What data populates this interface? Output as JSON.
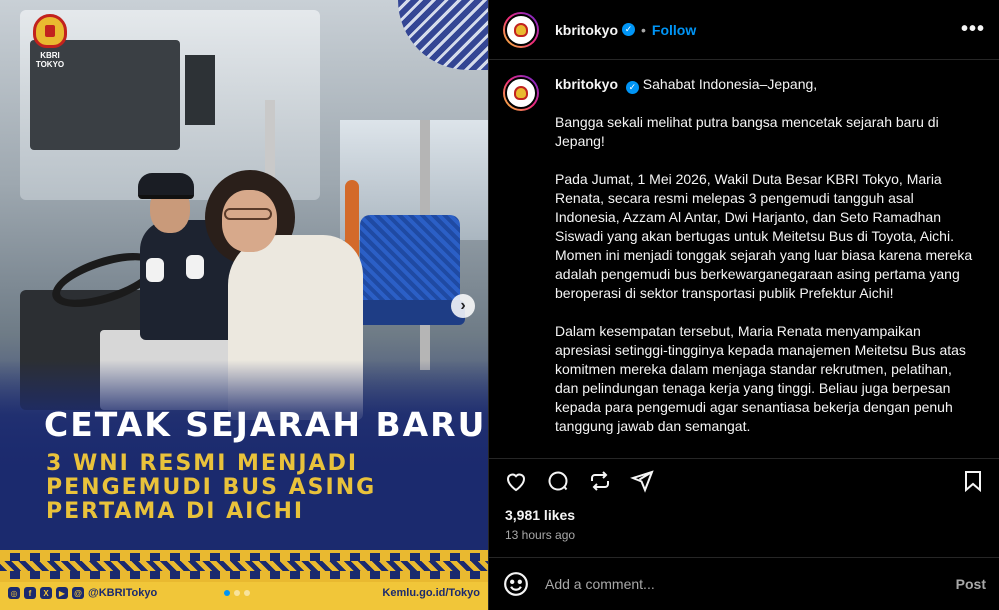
{
  "media": {
    "logo_text": "KBRI TOKYO",
    "headline": "CETAK SEJARAH BARU",
    "sub_lines": [
      "3 WNI RESMI MENJADI",
      "PENGEMUDI BUS ASING",
      "PERTAMA DI AICHI"
    ],
    "footer_handle": "@KBRITokyo",
    "footer_site": "Kemlu.go.id/Tokyo",
    "next_icon": "chevron-right-icon"
  },
  "header": {
    "username": "kbritokyo",
    "separator": "•",
    "follow_label": "Follow",
    "more_icon": "more-horizontal-icon"
  },
  "caption": {
    "username": "kbritokyo",
    "greeting": "Sahabat Indonesia–Jepang,",
    "paragraphs": [
      "Bangga sekali melihat putra bangsa mencetak sejarah baru di Jepang!",
      "Pada Jumat, 1 Mei 2026, Wakil Duta Besar KBRI Tokyo, Maria Renata, secara resmi melepas 3 pengemudi tangguh asal Indonesia, Azzam Al Antar, Dwi Harjanto, dan Seto Ramadhan Siswadi yang akan bertugas untuk Meitetsu Bus di Toyota, Aichi. Momen ini menjadi tonggak sejarah yang luar biasa karena mereka adalah pengemudi bus berkewarganegaraan asing pertama yang beroperasi di sektor transportasi publik Prefektur Aichi!",
      "Dalam kesempatan tersebut, Maria Renata menyampaikan apresiasi setinggi-tingginya kepada manajemen Meitetsu Bus atas komitmen mereka dalam menjaga standar rekrutmen, pelatihan, dan pelindungan tenaga kerja yang tinggi. Beliau juga berpesan kepada para pengemudi agar senantiasa bekerja dengan penuh tanggung jawab dan semangat."
    ]
  },
  "stats": {
    "likes": "3,981 likes",
    "time": "13 hours ago"
  },
  "comment": {
    "placeholder": "Add a comment...",
    "post_label": "Post"
  },
  "colors": {
    "accent": "#0095f6",
    "brand_navy": "#1b2a6e",
    "brand_gold": "#e9c23b"
  }
}
